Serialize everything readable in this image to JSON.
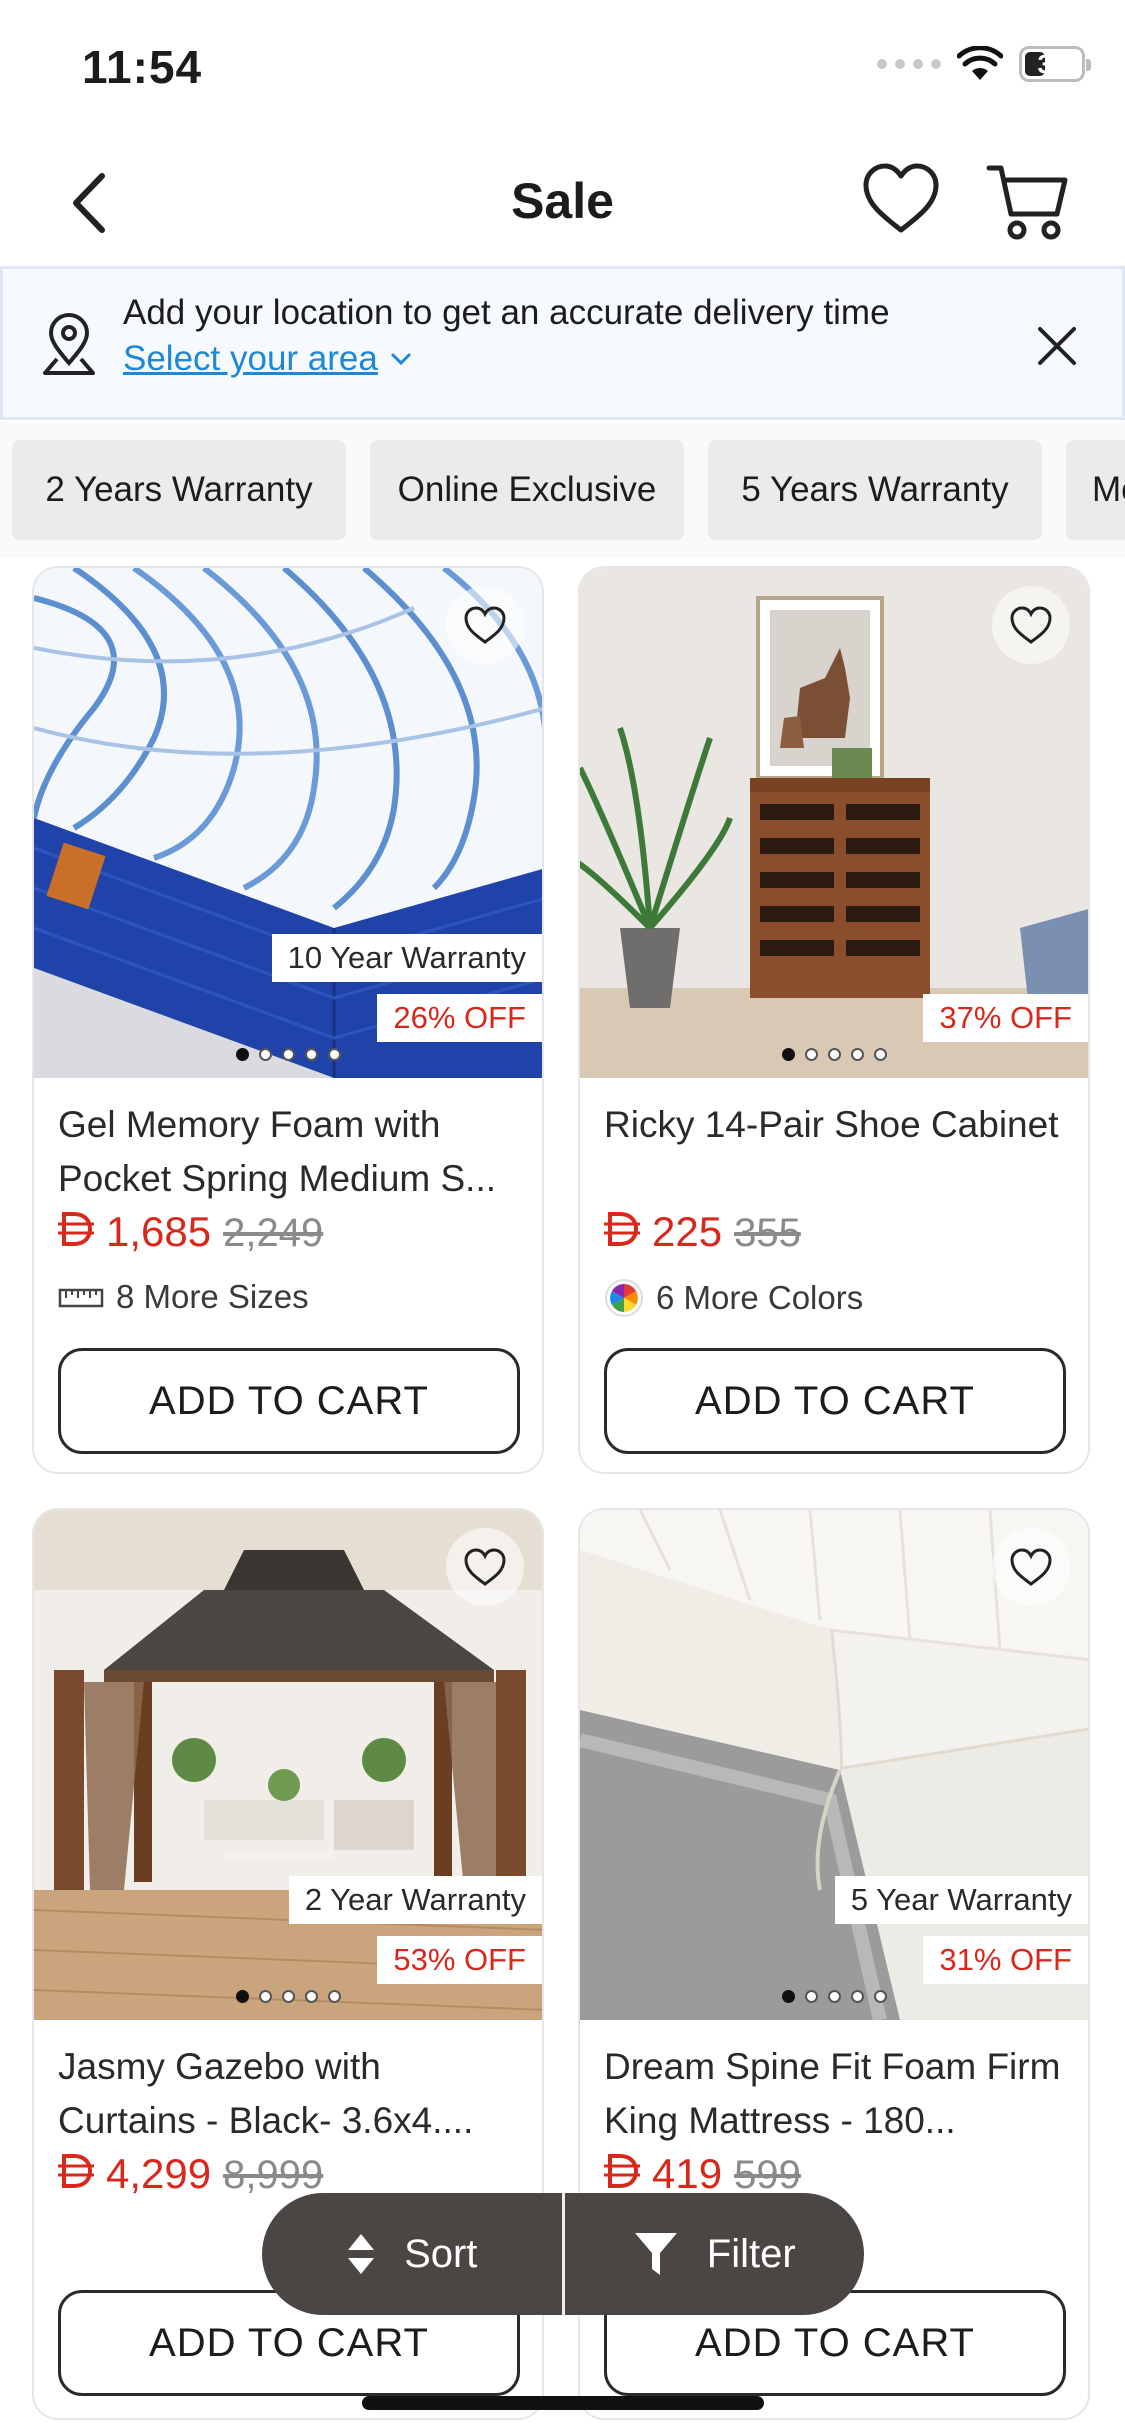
{
  "status": {
    "time": "11:54",
    "battery": "34"
  },
  "nav": {
    "title": "Sale"
  },
  "location": {
    "text": "Add your location to get an accurate delivery time",
    "link": "Select your area"
  },
  "chips": [
    "2 Years Warranty",
    "Online Exclusive",
    "5 Years Warranty",
    "Mo"
  ],
  "products": [
    {
      "title": "Gel Memory Foam with Pocket Spring Medium S...",
      "price": "1,685",
      "was": "2,249",
      "warranty": "10 Year Warranty",
      "discount": "26% OFF",
      "extra": "8 More Sizes",
      "extra_icon": "ruler-icon",
      "button": "ADD TO CART"
    },
    {
      "title": "Ricky 14-Pair Shoe Cabinet",
      "price": "225",
      "was": "355",
      "warranty": "",
      "discount": "37% OFF",
      "extra": "6 More Colors",
      "extra_icon": "color-wheel-icon",
      "button": "ADD TO CART"
    },
    {
      "title": "Jasmy Gazebo with Curtains - Black-  3.6x4....",
      "price": "4,299",
      "was": "8,999",
      "warranty": "2 Year Warranty",
      "discount": "53% OFF",
      "extra": "",
      "button": "ADD TO CART"
    },
    {
      "title": "Dream Spine Fit Foam Firm King Mattress - 180...",
      "price": "419",
      "was": "599",
      "warranty": "5 Year Warranty",
      "discount": "31% OFF",
      "extra": "",
      "button": "ADD TO CART"
    }
  ],
  "actions": {
    "sort": "Sort",
    "filter": "Filter"
  },
  "colors": {
    "accent_red": "#d8281c",
    "link_blue": "#1e88d6",
    "pill_bg": "#4b4643"
  }
}
